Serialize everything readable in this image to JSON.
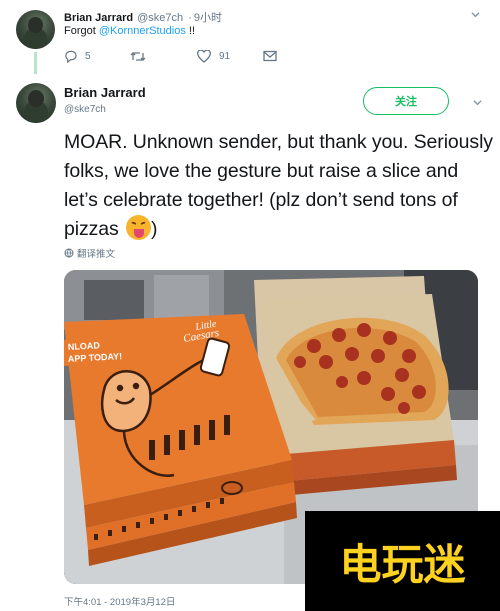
{
  "prev_tweet": {
    "author_name": "Brian Jarrard",
    "author_handle": "@ske7ch",
    "separator": "·",
    "time": "9小时",
    "text_prefix": "Forgot ",
    "mention": "@KornnerStudios",
    "text_suffix": " !!",
    "actions": {
      "reply_count": "5",
      "retweet_count": "",
      "like_count": "91"
    },
    "icons": [
      "reply-icon",
      "retweet-icon",
      "heart-icon",
      "mail-icon",
      "chevron-down-icon"
    ]
  },
  "main_tweet": {
    "author_name": "Brian Jarrard",
    "author_handle": "@ske7ch",
    "follow_label": "关注",
    "text": "MOAR. Unknown sender, but thank you. Seriously folks, we love the gesture but raise a slice and let’s celebrate together! (plz don’t send tons of pizzas",
    "text_end": ")",
    "emoji": "squinting-face-with-tongue",
    "translate_label": "翻译推文",
    "photo_text": {
      "box_line1": "NLOAD",
      "box_line2": "APP TODAY!",
      "brand_line1": "Little",
      "brand_line2": "Caesars"
    },
    "timestamp": "下午4:01 - 2019年3月12日"
  },
  "watermark": {
    "text": "电玩迷"
  },
  "colors": {
    "accent_green": "#17bf63",
    "link_blue": "#1da1f2",
    "muted": "#657786",
    "thread_line": "#b8e4c9",
    "box_orange": "#e87a2e"
  }
}
